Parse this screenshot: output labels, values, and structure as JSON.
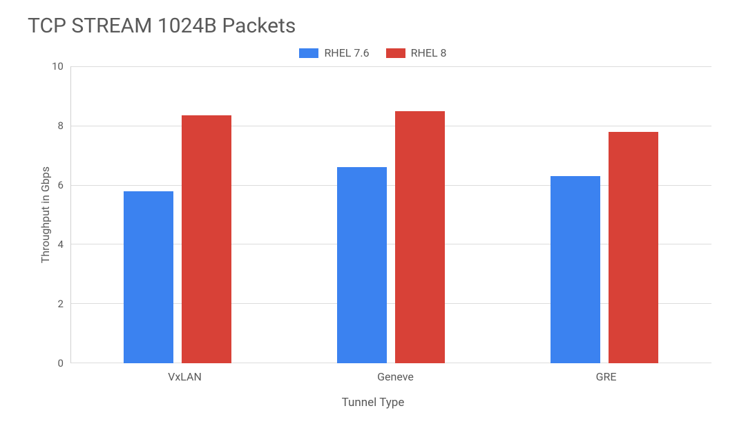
{
  "chart_data": {
    "type": "bar",
    "title": "TCP STREAM 1024B Packets",
    "xlabel": "Tunnel Type",
    "ylabel": "Throughput in Gbps",
    "categories": [
      "VxLAN",
      "Geneve",
      "GRE"
    ],
    "series": [
      {
        "name": "RHEL 7.6",
        "color": "#3b82f0",
        "values": [
          5.8,
          6.6,
          6.3
        ]
      },
      {
        "name": "RHEL 8",
        "color": "#d84137",
        "values": [
          8.35,
          8.5,
          7.8
        ]
      }
    ],
    "ylim": [
      0,
      10
    ],
    "yticks": [
      0,
      2,
      4,
      6,
      8,
      10
    ],
    "grid": true,
    "legend_position": "top"
  }
}
